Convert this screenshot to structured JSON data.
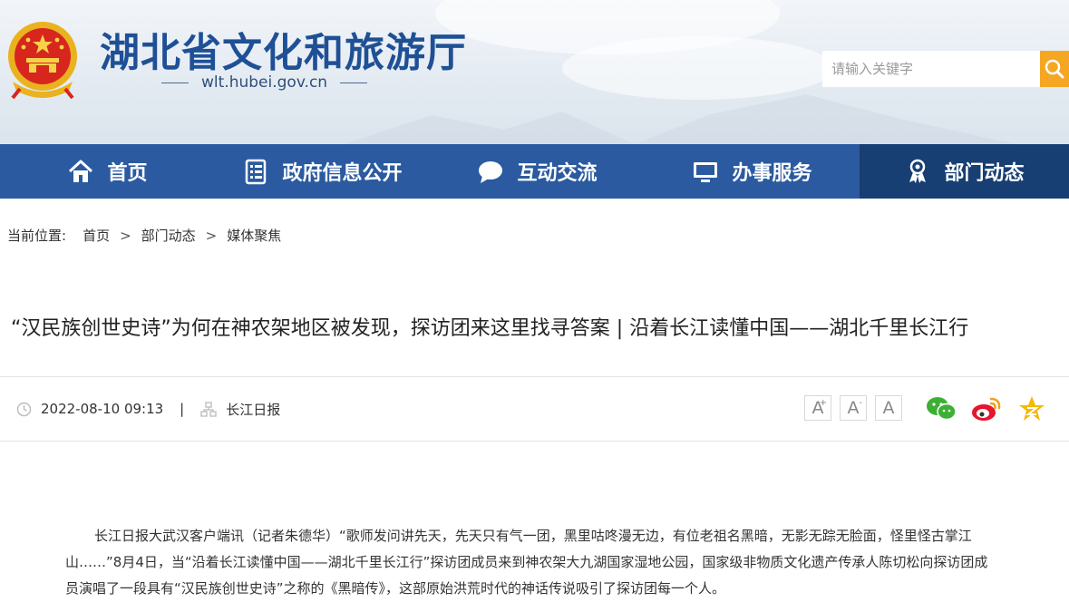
{
  "header": {
    "site_title": "湖北省文化和旅游厅",
    "site_url": "wlt.hubei.gov.cn",
    "search_placeholder": "请输入关键字"
  },
  "nav": {
    "items": [
      {
        "label": "首页",
        "icon": "home-icon"
      },
      {
        "label": "政府信息公开",
        "icon": "document-list-icon"
      },
      {
        "label": "互动交流",
        "icon": "chat-bubble-icon"
      },
      {
        "label": "办事服务",
        "icon": "monitor-icon"
      },
      {
        "label": "部门动态",
        "icon": "badge-person-icon",
        "active": true
      }
    ]
  },
  "breadcrumb": {
    "prefix": "当前位置:",
    "items": [
      "首页",
      "部门动态",
      "媒体聚焦"
    ],
    "separator": ">"
  },
  "article": {
    "title": "“汉民族创世史诗”为何在神农架地区被发现，探访团来这里找寻答案 | 沿着长江读懂中国——湖北千里长江行",
    "date": "2022-08-10 09:13",
    "meta_separator": "|",
    "source": "长江日报",
    "font_controls": [
      "A",
      "A",
      "A"
    ],
    "font_control_marks": [
      "+",
      "-",
      ""
    ],
    "share_icons": [
      "wechat-icon",
      "weibo-icon",
      "qzone-icon"
    ],
    "body": "长江日报大武汉客户端讯（记者朱德华）“歌师发问讲先天，先天只有气一团，黑里咕咚漫无边，有位老祖名黑暗，无影无踪无脸面，怪里怪古掌江山……”8月4日，当“沿着长江读懂中国——湖北千里长江行”探访团成员来到神农架大九湖国家湿地公园，国家级非物质文化遗产传承人陈切松向探访团成员演唱了一段具有“汉民族创世史诗”之称的《黑暗传》，这部原始洪荒时代的神话传说吸引了探访团每一个人。"
  },
  "colors": {
    "brand_blue": "#1f5096",
    "nav_bg": "#2b5aa0",
    "nav_active_bg": "#183f73",
    "search_button": "#f5a623",
    "wechat_green": "#3cb034",
    "weibo_orange": "#f0a01a",
    "qzone_yellow": "#f6b800"
  }
}
